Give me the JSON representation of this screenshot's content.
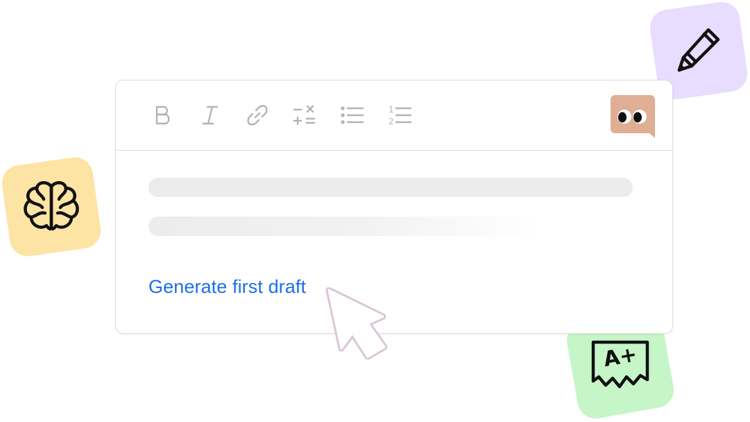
{
  "toolbar": {
    "tools": [
      {
        "name": "bold",
        "icon": "bold-icon"
      },
      {
        "name": "italic",
        "icon": "italic-icon"
      },
      {
        "name": "link",
        "icon": "link-icon"
      },
      {
        "name": "math",
        "icon": "math-operators-icon"
      },
      {
        "name": "bulleted-list",
        "icon": "bulleted-list-icon"
      },
      {
        "name": "numbered-list",
        "icon": "numbered-list-icon"
      }
    ],
    "numbered_list_digits": [
      "1",
      "2"
    ],
    "icon_color": "#b3b3b3"
  },
  "assistant": {
    "icon": "eyes-assistant-icon",
    "color": "#dfae94"
  },
  "editor": {
    "placeholder_color": "#ececec",
    "generate_label": "Generate first draft",
    "link_color": "#1a6fe8"
  },
  "cursor": {
    "icon": "mouse-pointer-icon",
    "color": "#d9c7d6"
  },
  "badges": [
    {
      "name": "pencil",
      "icon": "pencil-icon",
      "color": "#e8dcff"
    },
    {
      "name": "brain",
      "icon": "brain-icon",
      "color": "#fde4a4"
    },
    {
      "name": "grade",
      "icon": "a-plus-grade-icon",
      "text": "A+",
      "color": "#c6f5c8"
    }
  ]
}
